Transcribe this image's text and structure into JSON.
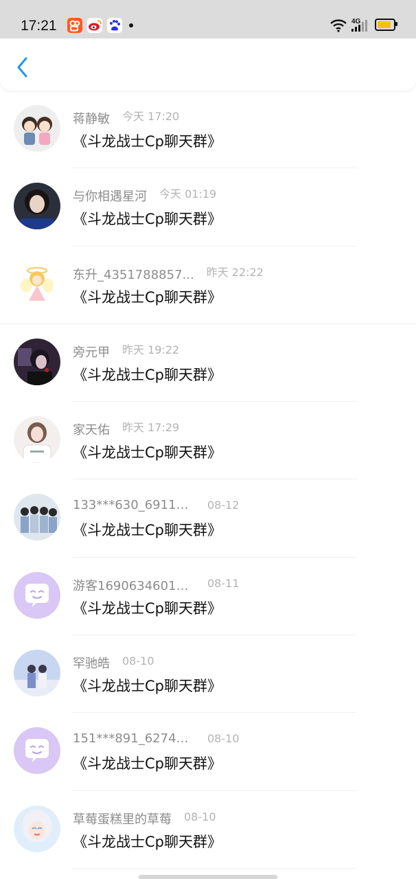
{
  "status_bar": {
    "time": "17:21",
    "app_icons": [
      "kuaishou-icon",
      "weibo-icon",
      "baidu-icon"
    ],
    "network": "4G",
    "battery_level": 0.85
  },
  "nav": {
    "back_icon": "chevron-left-icon",
    "accent_color": "#2196f3"
  },
  "messages": [
    {
      "name": "蒋静敏",
      "time": "今天 17:20",
      "text": "《斗龙战士Cp聊天群》",
      "avatar": "couple-cartoon"
    },
    {
      "name": "与你相遇星河",
      "time": "今天 01:19",
      "text": "《斗龙战士Cp聊天群》",
      "avatar": "girl-portrait"
    },
    {
      "name": "东升_4351788857...",
      "time": "昨天 22:22",
      "text": "《斗龙战士Cp聊天群》",
      "avatar": "angel-doll"
    },
    {
      "name": "旁元甲",
      "time": "昨天 19:22",
      "text": "《斗龙战士Cp聊天群》",
      "avatar": "anime-dark"
    },
    {
      "name": "家天佑",
      "time": "昨天 17:29",
      "text": "《斗龙战士Cp聊天群》",
      "avatar": "girl-white"
    },
    {
      "name": "133***630_69117...",
      "time": "08-12",
      "text": "《斗龙战士Cp聊天群》",
      "avatar": "boy-group"
    },
    {
      "name": "游客16906346010...",
      "time": "08-11",
      "text": "《斗龙战士Cp聊天群》",
      "avatar": "default-chat"
    },
    {
      "name": "罕驰皓",
      "time": "08-10",
      "text": "《斗龙战士Cp聊天群》",
      "avatar": "couple-sky"
    },
    {
      "name": "151***891_62744...",
      "time": "08-10",
      "text": "《斗龙战士Cp聊天群》",
      "avatar": "default-chat"
    },
    {
      "name": "草莓蛋糕里的草莓",
      "time": "08-10",
      "text": "《斗龙战士Cp聊天群》",
      "avatar": "anime-girl"
    }
  ]
}
